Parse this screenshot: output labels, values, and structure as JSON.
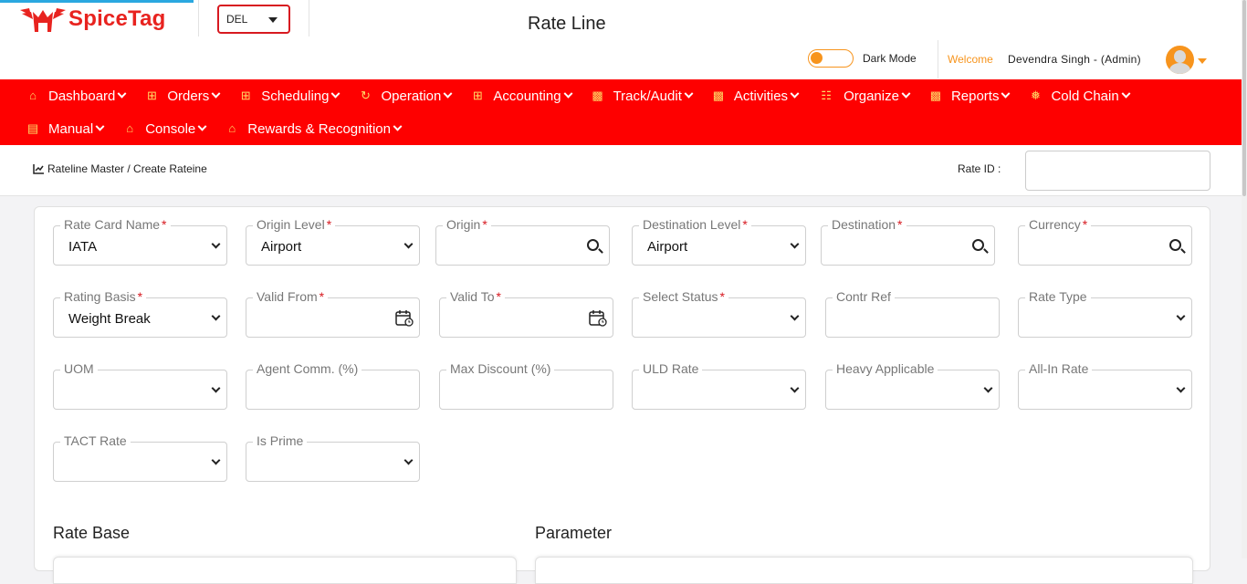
{
  "header": {
    "brand": "SpiceTag",
    "station": "DEL",
    "title": "Rate Line",
    "dark_mode_label": "Dark Mode",
    "welcome_label": "Welcome",
    "user_name": "Devendra Singh - (Admin)"
  },
  "nav": {
    "row1": [
      {
        "label": "Dashboard",
        "icon": "home-icon"
      },
      {
        "label": "Orders",
        "icon": "plus-square-icon"
      },
      {
        "label": "Scheduling",
        "icon": "plus-square-icon"
      },
      {
        "label": "Operation",
        "icon": "timer-icon"
      },
      {
        "label": "Accounting",
        "icon": "plus-square-icon"
      },
      {
        "label": "Track/Audit",
        "icon": "document-icon"
      },
      {
        "label": "Activities",
        "icon": "document-icon"
      },
      {
        "label": "Organize",
        "icon": "sitemap-icon"
      },
      {
        "label": "Reports",
        "icon": "file-icon"
      },
      {
        "label": "Cold Chain",
        "icon": "snowflake-icon"
      }
    ],
    "row2": [
      {
        "label": "Manual",
        "icon": "book-icon"
      },
      {
        "label": "Console",
        "icon": "home-icon"
      },
      {
        "label": "Rewards & Recognition",
        "icon": "home-icon"
      }
    ]
  },
  "breadcrumb": {
    "text": "Rateline Master / Create Rateine",
    "rate_id_label": "Rate ID :"
  },
  "form": {
    "rate_card_name": {
      "label": "Rate Card Name",
      "value": "IATA"
    },
    "origin_level": {
      "label": "Origin Level",
      "value": "Airport"
    },
    "origin": {
      "label": "Origin",
      "value": ""
    },
    "destination_level": {
      "label": "Destination Level",
      "value": "Airport"
    },
    "destination": {
      "label": "Destination",
      "value": ""
    },
    "currency": {
      "label": "Currency",
      "value": ""
    },
    "rating_basis": {
      "label": "Rating Basis",
      "value": "Weight Break"
    },
    "valid_from": {
      "label": "Valid From",
      "value": ""
    },
    "valid_to": {
      "label": "Valid To",
      "value": ""
    },
    "select_status": {
      "label": "Select Status",
      "value": ""
    },
    "contr_ref": {
      "label": "Contr Ref",
      "value": ""
    },
    "rate_type": {
      "label": "Rate Type",
      "value": ""
    },
    "uom": {
      "label": "UOM",
      "value": ""
    },
    "agent_comm": {
      "label": "Agent Comm. (%)",
      "value": ""
    },
    "max_discount": {
      "label": "Max Discount (%)",
      "value": ""
    },
    "uld_rate": {
      "label": "ULD Rate",
      "value": ""
    },
    "heavy_applicable": {
      "label": "Heavy Applicable",
      "value": ""
    },
    "all_in_rate": {
      "label": "All-In Rate",
      "value": ""
    },
    "tact_rate": {
      "label": "TACT Rate",
      "value": ""
    },
    "is_prime": {
      "label": "Is Prime",
      "value": ""
    }
  },
  "sections": {
    "rate_base": "Rate Base",
    "parameter": "Parameter"
  },
  "colors": {
    "nav_bg": "#fe0000",
    "accent": "#f7941d",
    "brand": "#e8231f",
    "required": "#d71920"
  }
}
